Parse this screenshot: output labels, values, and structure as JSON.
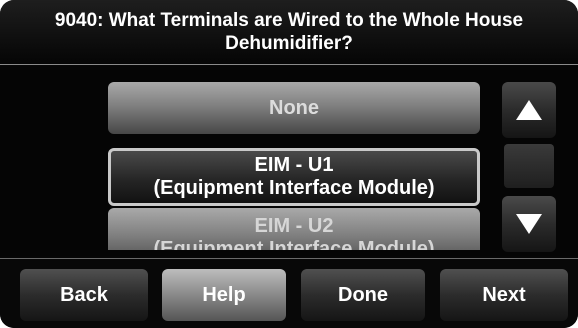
{
  "header": {
    "title": "9040: What Terminals are Wired to the Whole House Dehumidifier?"
  },
  "options": [
    {
      "line1": "None",
      "line2": ""
    },
    {
      "line1": "EIM - U1",
      "line2": "(Equipment Interface Module)",
      "selected": true
    },
    {
      "line1": "EIM - U2",
      "line2": "(Equipment Interface Module)"
    }
  ],
  "scroll": {
    "up_icon": "arrow-up-icon",
    "down_icon": "arrow-down-icon"
  },
  "footer": {
    "back_label": "Back",
    "help_label": "Help",
    "done_label": "Done",
    "next_label": "Next"
  },
  "colors": {
    "background": "#060606",
    "selected_border": "#c9c9c9",
    "light_button": "#8e8e8e",
    "dark_button": "#2c2c2c"
  }
}
